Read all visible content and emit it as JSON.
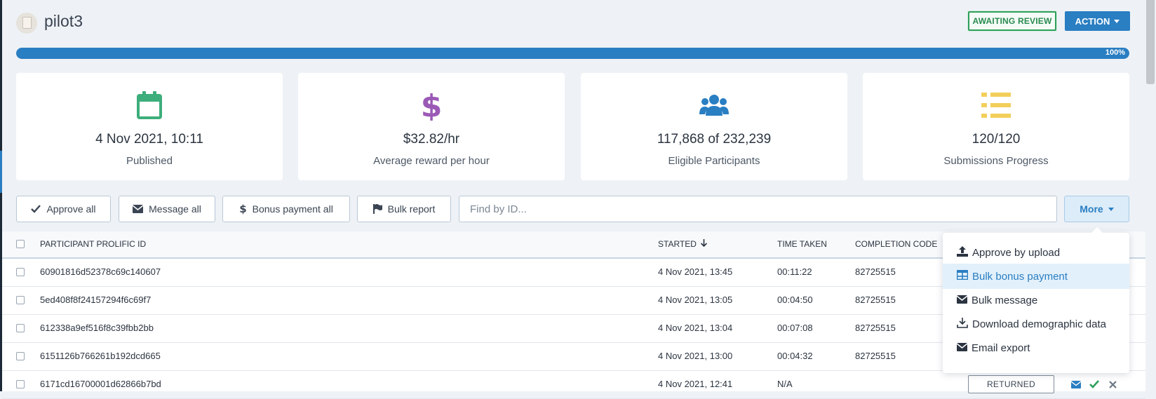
{
  "header": {
    "study_title": "pilot3",
    "status_badge": "AWAITING REVIEW",
    "action_label": "ACTION"
  },
  "progress": {
    "percent": 100,
    "label": "100%"
  },
  "stats": [
    {
      "icon": "calendar-icon",
      "value": "4 Nov 2021, 10:11",
      "label": "Published",
      "color": "#3dae7b"
    },
    {
      "icon": "dollar-icon",
      "value": "$32.82/hr",
      "label": "Average reward per hour",
      "color": "#9b59b6"
    },
    {
      "icon": "users-icon",
      "value": "117,868 of 232,239",
      "label": "Eligible Participants",
      "color": "#2a7ec2"
    },
    {
      "icon": "list-icon",
      "value": "120/120",
      "label": "Submissions Progress",
      "color": "#f2cf5b"
    }
  ],
  "toolbar": {
    "approve_all": "Approve all",
    "message_all": "Message all",
    "bonus_payment_all": "Bonus payment all",
    "bulk_report": "Bulk report",
    "search_placeholder": "Find by ID...",
    "more": "More"
  },
  "more_menu": {
    "items": [
      {
        "icon": "upload-icon",
        "label": "Approve by upload"
      },
      {
        "icon": "table-icon",
        "label": "Bulk bonus payment",
        "active": true
      },
      {
        "icon": "envelope-icon",
        "label": "Bulk message"
      },
      {
        "icon": "download-icon",
        "label": "Download demographic data"
      },
      {
        "icon": "envelope-icon",
        "label": "Email export"
      }
    ]
  },
  "table": {
    "columns": {
      "participant_id": "PARTICIPANT PROLIFIC ID",
      "started": "STARTED",
      "time_taken": "TIME TAKEN",
      "completion_code": "COMPLETION CODE"
    },
    "rows": [
      {
        "id": "60901816d52378c69c140607",
        "started": "4 Nov 2021, 13:45",
        "time": "00:11:22",
        "code": "82725515"
      },
      {
        "id": "5ed408f8f24157294f6c69f7",
        "started": "4 Nov 2021, 13:05",
        "time": "00:04:50",
        "code": "82725515"
      },
      {
        "id": "612338a9ef516f8c39fbb2bb",
        "started": "4 Nov 2021, 13:04",
        "time": "00:07:08",
        "code": "82725515"
      },
      {
        "id": "6151126b766261b192dcd665",
        "started": "4 Nov 2021, 13:00",
        "time": "00:04:32",
        "code": "82725515"
      },
      {
        "id": "6171cd16700001d62866b7bd",
        "started": "4 Nov 2021, 12:41",
        "time": "N/A",
        "code": "",
        "status": "RETURNED"
      }
    ]
  }
}
